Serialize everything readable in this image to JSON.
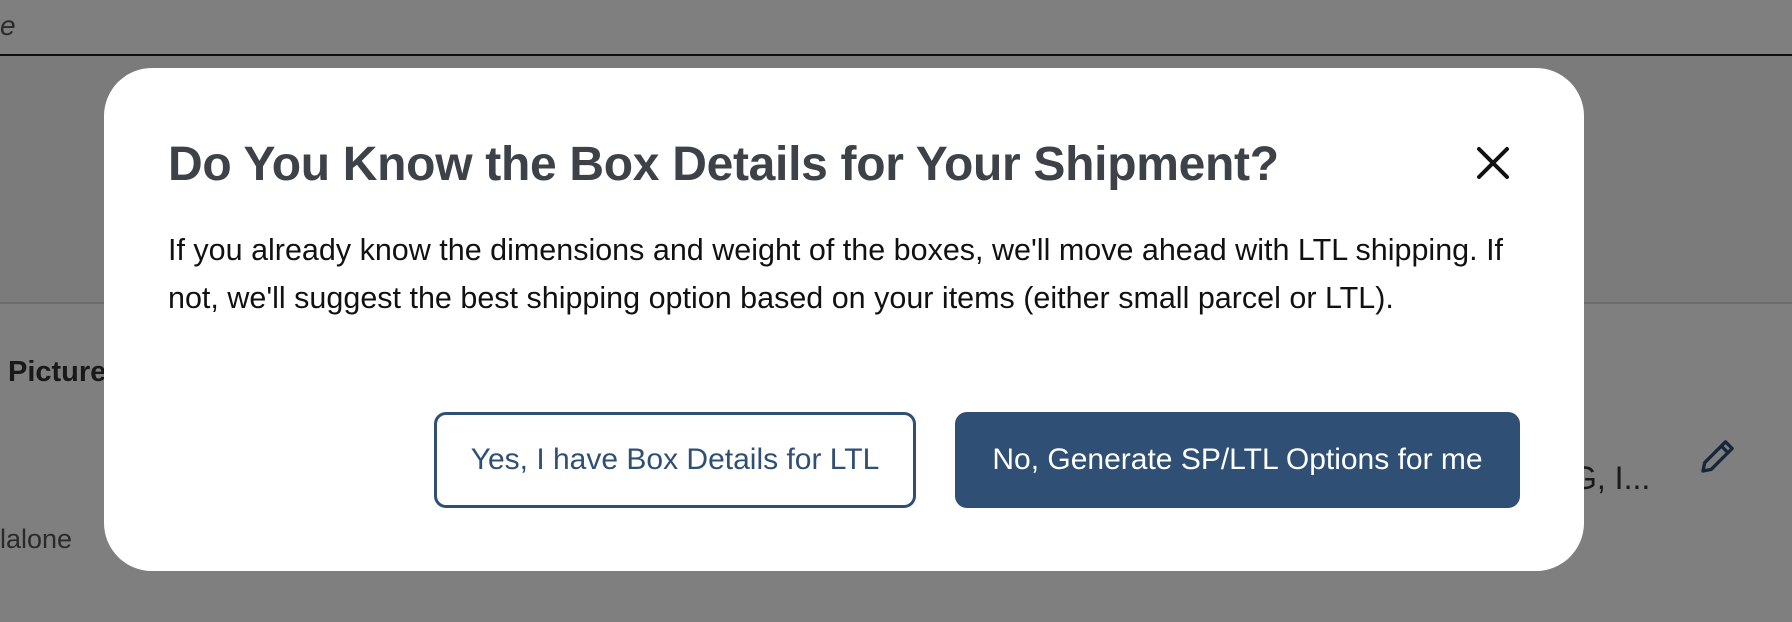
{
  "background": {
    "topbar_text": "e",
    "section_label": "Picture",
    "standalone_text": "lalone",
    "truncated_text": "G, I..."
  },
  "modal": {
    "title": "Do You Know the Box Details for Your Shipment?",
    "body": "If you already know the dimensions and weight of the boxes, we'll move ahead with LTL shipping. If not, we'll suggest the best shipping option based on your items (either small parcel or LTL).",
    "yes_button_label": "Yes, I have Box Details for LTL",
    "no_button_label": "No, Generate SP/LTL Options for me",
    "close_icon": "close-icon"
  },
  "colors": {
    "primary": "#2f4f74",
    "title": "#3d4148",
    "overlay": "rgba(0,0,0,0.5)"
  }
}
